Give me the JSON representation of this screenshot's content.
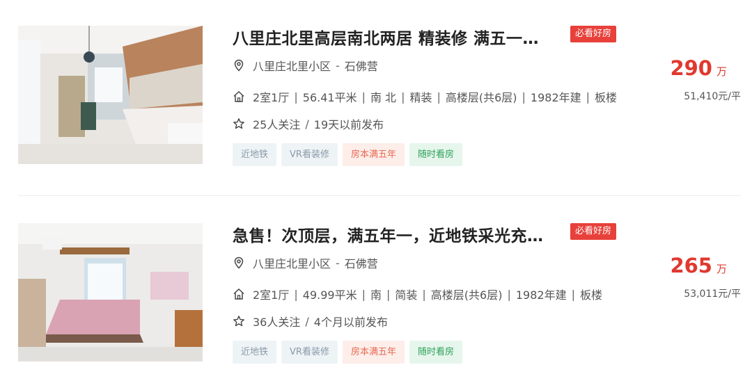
{
  "listings": [
    {
      "title": "八里庄北里高层南北两居 精装修 满五一…",
      "badge": "必看好房",
      "community": "八里庄北里小区",
      "area": "石佛营",
      "dash": "-",
      "details": [
        "2室1厅",
        "56.41平米",
        "南 北",
        "精装",
        "高楼层(共6层)",
        "1982年建",
        "板楼"
      ],
      "followers": "25人关注",
      "published": "19天以前发布",
      "price": "290",
      "price_unit": "万",
      "unit_price": "51,410元/平",
      "tags": [
        "近地铁",
        "VR看装修",
        "房本满五年",
        "随时看房"
      ]
    },
    {
      "title": "急售！次顶层，满五年一，近地铁采光充…",
      "badge": "必看好房",
      "community": "八里庄北里小区",
      "area": "石佛营",
      "dash": "-",
      "details": [
        "2室1厅",
        "49.99平米",
        "南",
        "简装",
        "高楼层(共6层)",
        "1982年建",
        "板楼"
      ],
      "followers": "36人关注",
      "published": "4个月以前发布",
      "price": "265",
      "price_unit": "万",
      "unit_price": "53,011元/平",
      "tags": [
        "近地铁",
        "VR看装修",
        "房本满五年",
        "随时看房"
      ]
    }
  ],
  "separators": {
    "pipe": "|",
    "slash": "/"
  },
  "icons": {
    "location": "location-pin-icon",
    "house": "house-icon",
    "star": "star-icon"
  },
  "colors": {
    "price": "#e0392f",
    "badge": "#e8403a"
  }
}
